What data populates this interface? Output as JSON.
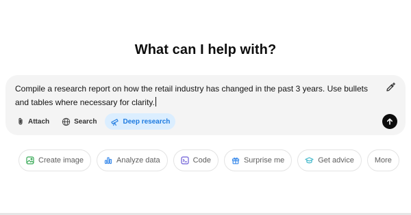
{
  "heading": "What can I help with?",
  "composer": {
    "prompt_text": "Compile a research report on how the retail industry has changed in the past 3 years. Use bullets and tables where necessary for clarity.",
    "tools": {
      "attach": "Attach",
      "search": "Search",
      "deep_research": "Deep research"
    },
    "send_icon": "arrow-up-icon",
    "edit_icon": "pen-sparkle-icon"
  },
  "suggestions": [
    {
      "label": "Create image",
      "icon": "image-icon",
      "color": "#34a853"
    },
    {
      "label": "Analyze data",
      "icon": "bar-chart-icon",
      "color": "#3b8beb"
    },
    {
      "label": "Code",
      "icon": "terminal-icon",
      "color": "#6b5bd6"
    },
    {
      "label": "Surprise me",
      "icon": "gift-icon",
      "color": "#3b8beb"
    },
    {
      "label": "Get advice",
      "icon": "graduation-cap-icon",
      "color": "#3bb6c9"
    },
    {
      "label": "More",
      "icon": "",
      "color": ""
    }
  ],
  "colors": {
    "accent": "#1e7be0",
    "accent_bg": "#dbeeff",
    "composer_bg": "#f4f4f4"
  }
}
